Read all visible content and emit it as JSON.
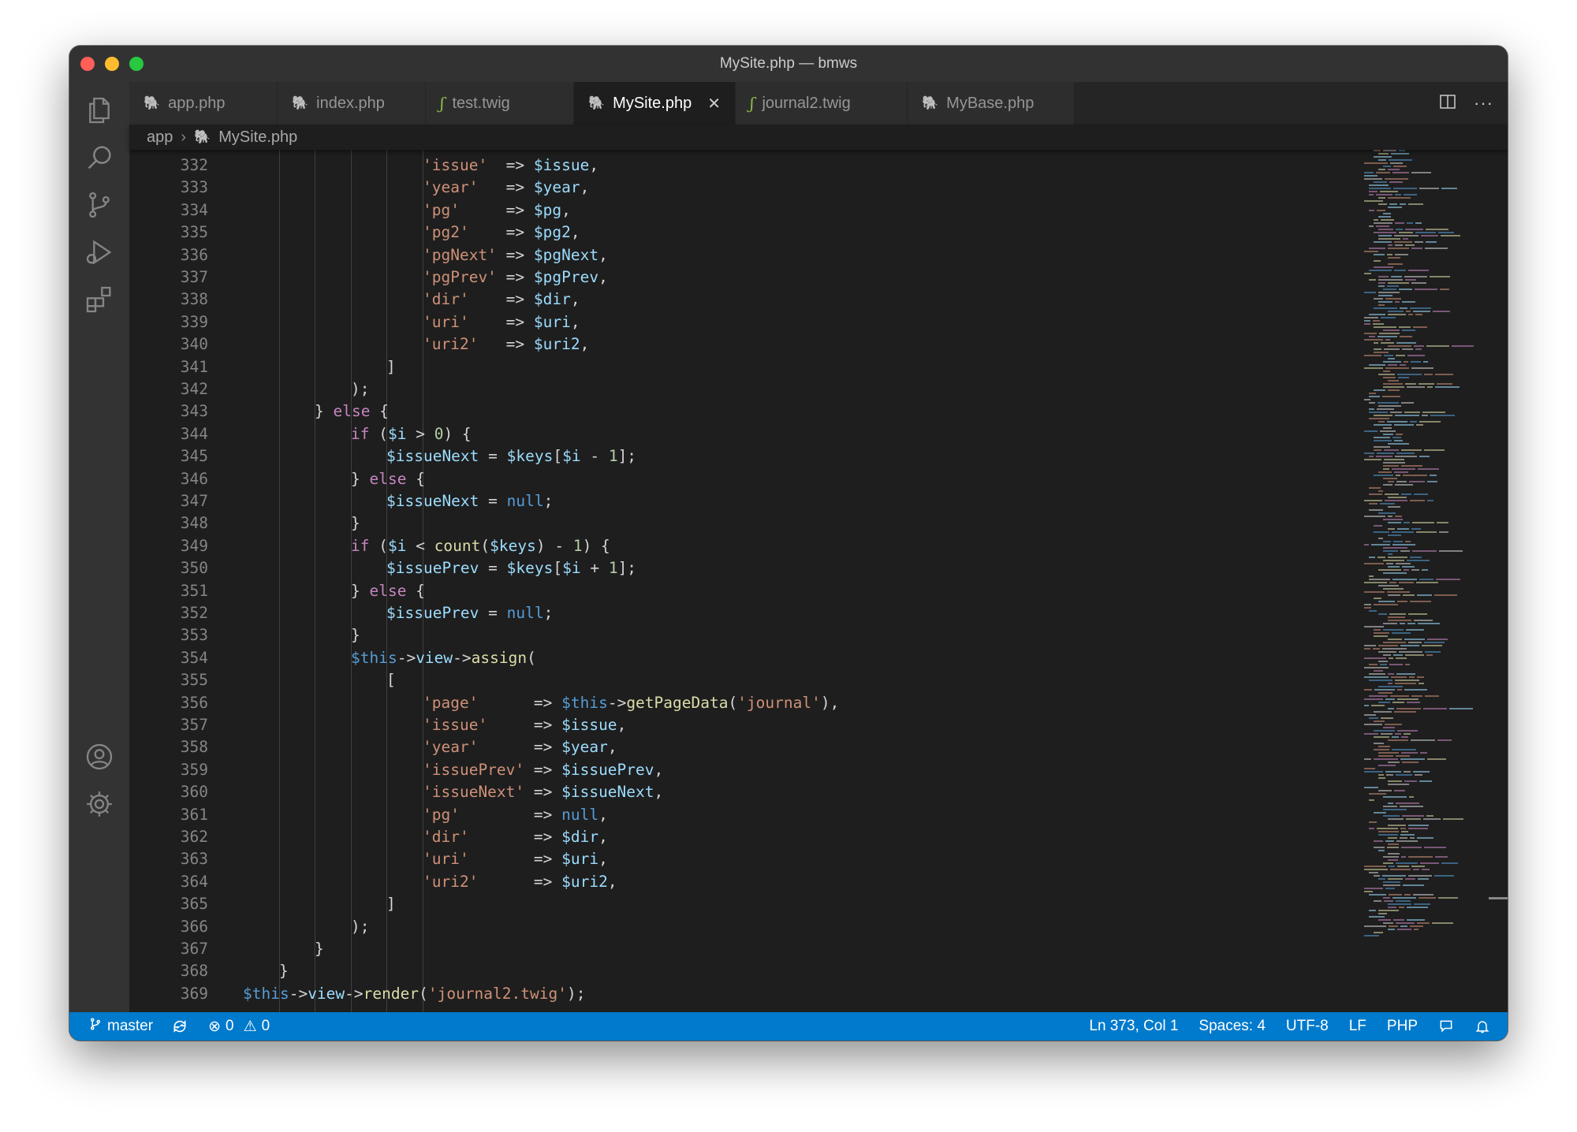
{
  "window": {
    "title": "MySite.php — bmws"
  },
  "tabs": [
    {
      "label": "app.php",
      "icon": "php-elephant-icon",
      "active": false
    },
    {
      "label": "index.php",
      "icon": "php-elephant-icon",
      "active": false
    },
    {
      "label": "test.twig",
      "icon": "twig-icon",
      "active": false
    },
    {
      "label": "MySite.php",
      "icon": "php-elephant-icon",
      "active": true
    },
    {
      "label": "journal2.twig",
      "icon": "twig-icon",
      "active": false
    },
    {
      "label": "MyBase.php",
      "icon": "php-elephant-icon",
      "active": false
    }
  ],
  "breadcrumb": {
    "folder": "app",
    "file": "MySite.php"
  },
  "activity_bar": [
    "files-icon",
    "search-icon",
    "source-control-icon",
    "run-debug-icon",
    "extensions-icon",
    "account-icon",
    "settings-gear-icon"
  ],
  "editor": {
    "language": "PHP",
    "lines": [
      {
        "n": "332",
        "text": "'issue'  => $issue,"
      },
      {
        "n": "333",
        "text": "'year'   => $year,"
      },
      {
        "n": "334",
        "text": "'pg'     => $pg,"
      },
      {
        "n": "335",
        "text": "'pg2'    => $pg2,"
      },
      {
        "n": "336",
        "text": "'pgNext' => $pgNext,"
      },
      {
        "n": "337",
        "text": "'pgPrev' => $pgPrev,"
      },
      {
        "n": "338",
        "text": "'dir'    => $dir,"
      },
      {
        "n": "339",
        "text": "'uri'    => $uri,"
      },
      {
        "n": "340",
        "text": "'uri2'   => $uri2,"
      },
      {
        "n": "341",
        "text": "]"
      },
      {
        "n": "342",
        "text": ");"
      },
      {
        "n": "343",
        "text": "} else {"
      },
      {
        "n": "344",
        "text": "if ($i > 0) {"
      },
      {
        "n": "345",
        "text": "$issueNext = $keys[$i - 1];"
      },
      {
        "n": "346",
        "text": "} else {"
      },
      {
        "n": "347",
        "text": "$issueNext = null;"
      },
      {
        "n": "348",
        "text": "}"
      },
      {
        "n": "349",
        "text": "if ($i < count($keys) - 1) {"
      },
      {
        "n": "350",
        "text": "$issuePrev = $keys[$i + 1];"
      },
      {
        "n": "351",
        "text": "} else {"
      },
      {
        "n": "352",
        "text": "$issuePrev = null;"
      },
      {
        "n": "353",
        "text": "}"
      },
      {
        "n": "354",
        "text": "$this->view->assign("
      },
      {
        "n": "355",
        "text": "["
      },
      {
        "n": "356",
        "text": "'page'      => $this->getPageData('journal'),"
      },
      {
        "n": "357",
        "text": "'issue'     => $issue,"
      },
      {
        "n": "358",
        "text": "'year'      => $year,"
      },
      {
        "n": "359",
        "text": "'issuePrev' => $issuePrev,"
      },
      {
        "n": "360",
        "text": "'issueNext' => $issueNext,"
      },
      {
        "n": "361",
        "text": "'pg'        => null,"
      },
      {
        "n": "362",
        "text": "'dir'       => $dir,"
      },
      {
        "n": "363",
        "text": "'uri'       => $uri,"
      },
      {
        "n": "364",
        "text": "'uri2'      => $uri2,"
      },
      {
        "n": "365",
        "text": "]"
      },
      {
        "n": "366",
        "text": ");"
      },
      {
        "n": "367",
        "text": "}"
      },
      {
        "n": "368",
        "text": "}"
      },
      {
        "n": "369",
        "text": "$this->view->render('journal2.twig');"
      }
    ]
  },
  "status": {
    "branch": "master",
    "errors": "0",
    "warnings": "0",
    "cursor": "Ln 373, Col 1",
    "spaces": "Spaces: 4",
    "encoding": "UTF-8",
    "eol": "LF",
    "language": "PHP"
  },
  "colors": {
    "status_bar": "#007acc",
    "editor_bg": "#1e1e1e",
    "string": "#ce9178",
    "variable": "#9cdcfe",
    "keyword": "#c586c0",
    "function": "#dcdcaa"
  }
}
